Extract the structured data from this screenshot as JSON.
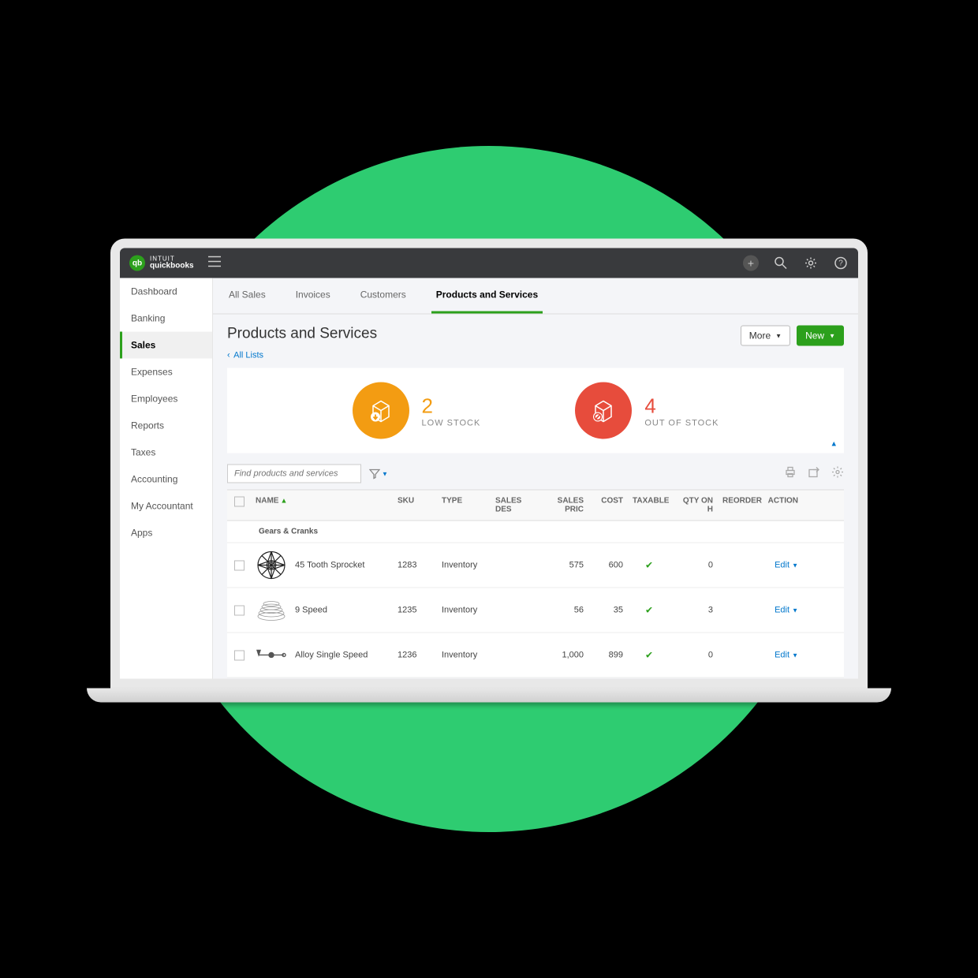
{
  "brand": {
    "short": "qb",
    "line1": "INTUIT",
    "line2": "quickbooks"
  },
  "sidebar": {
    "items": [
      {
        "label": "Dashboard"
      },
      {
        "label": "Banking"
      },
      {
        "label": "Sales",
        "active": true
      },
      {
        "label": "Expenses"
      },
      {
        "label": "Employees"
      },
      {
        "label": "Reports"
      },
      {
        "label": "Taxes"
      },
      {
        "label": "Accounting"
      },
      {
        "label": "My Accountant"
      },
      {
        "label": "Apps"
      }
    ]
  },
  "tabs": [
    {
      "label": "All Sales"
    },
    {
      "label": "Invoices"
    },
    {
      "label": "Customers"
    },
    {
      "label": "Products and Services",
      "active": true
    }
  ],
  "page": {
    "title": "Products and Services",
    "breadcrumb": "All Lists",
    "more_label": "More",
    "new_label": "New"
  },
  "stats": {
    "low_stock": {
      "count": "2",
      "label": "LOW STOCK"
    },
    "out_of_stock": {
      "count": "4",
      "label": "OUT OF STOCK"
    }
  },
  "search": {
    "placeholder": "Find products and services"
  },
  "columns": {
    "name": "NAME",
    "sku": "SKU",
    "type": "TYPE",
    "desc": "SALES DES",
    "price": "SALES PRIC",
    "cost": "COST",
    "taxable": "TAXABLE",
    "qty": "QTY ON H",
    "reorder": "REORDER",
    "action": "ACTION"
  },
  "group": "Gears & Cranks",
  "rows": [
    {
      "name": "45 Tooth Sprocket",
      "sku": "1283",
      "type": "Inventory",
      "price": "575",
      "cost": "600",
      "taxable": true,
      "qty": "0",
      "qty_low": true,
      "action": "Edit"
    },
    {
      "name": "9 Speed",
      "sku": "1235",
      "type": "Inventory",
      "price": "56",
      "cost": "35",
      "taxable": true,
      "qty": "3",
      "qty_low": true,
      "action": "Edit"
    },
    {
      "name": "Alloy Single Speed",
      "sku": "1236",
      "type": "Inventory",
      "price": "1,000",
      "cost": "899",
      "taxable": true,
      "qty": "0",
      "qty_low": true,
      "action": "Edit"
    }
  ]
}
